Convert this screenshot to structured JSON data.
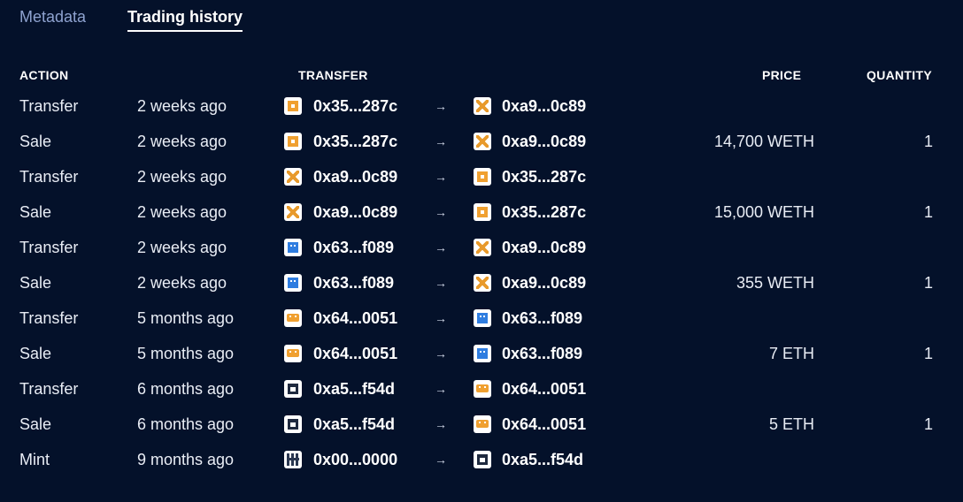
{
  "tabs": [
    {
      "label": "Metadata"
    },
    {
      "label": "Trading history"
    }
  ],
  "headers": {
    "action": "ACTION",
    "transfer": "TRANSFER",
    "price": "PRICE",
    "quantity": "QUANTITY"
  },
  "rows": [
    {
      "action": "Transfer",
      "time": "2 weeks ago",
      "from": "0x35...287c",
      "from_icon": "orange-square-avatar-icon",
      "to": "0xa9...0c89",
      "to_icon": "orange-x-avatar-icon",
      "price": "",
      "quantity": ""
    },
    {
      "action": "Sale",
      "time": "2 weeks ago",
      "from": "0x35...287c",
      "from_icon": "orange-square-avatar-icon",
      "to": "0xa9...0c89",
      "to_icon": "orange-x-avatar-icon",
      "price": "14,700 WETH",
      "quantity": "1"
    },
    {
      "action": "Transfer",
      "time": "2 weeks ago",
      "from": "0xa9...0c89",
      "from_icon": "orange-x-avatar-icon",
      "to": "0x35...287c",
      "to_icon": "orange-square-avatar-icon",
      "price": "",
      "quantity": ""
    },
    {
      "action": "Sale",
      "time": "2 weeks ago",
      "from": "0xa9...0c89",
      "from_icon": "orange-x-avatar-icon",
      "to": "0x35...287c",
      "to_icon": "orange-square-avatar-icon",
      "price": "15,000 WETH",
      "quantity": "1"
    },
    {
      "action": "Transfer",
      "time": "2 weeks ago",
      "from": "0x63...f089",
      "from_icon": "blue-avatar-icon",
      "to": "0xa9...0c89",
      "to_icon": "orange-x-avatar-icon",
      "price": "",
      "quantity": ""
    },
    {
      "action": "Sale",
      "time": "2 weeks ago",
      "from": "0x63...f089",
      "from_icon": "blue-avatar-icon",
      "to": "0xa9...0c89",
      "to_icon": "orange-x-avatar-icon",
      "price": "355 WETH",
      "quantity": "1"
    },
    {
      "action": "Transfer",
      "time": "5 months ago",
      "from": "0x64...0051",
      "from_icon": "orange-crab-avatar-icon",
      "to": "0x63...f089",
      "to_icon": "blue-avatar-icon",
      "price": "",
      "quantity": ""
    },
    {
      "action": "Sale",
      "time": "5 months ago",
      "from": "0x64...0051",
      "from_icon": "orange-crab-avatar-icon",
      "to": "0x63...f089",
      "to_icon": "blue-avatar-icon",
      "price": "7 ETH",
      "quantity": "1"
    },
    {
      "action": "Transfer",
      "time": "6 months ago",
      "from": "0xa5...f54d",
      "from_icon": "dark-box-avatar-icon",
      "to": "0x64...0051",
      "to_icon": "orange-crab-avatar-icon",
      "price": "",
      "quantity": ""
    },
    {
      "action": "Sale",
      "time": "6 months ago",
      "from": "0xa5...f54d",
      "from_icon": "dark-box-avatar-icon",
      "to": "0x64...0051",
      "to_icon": "orange-crab-avatar-icon",
      "price": "5 ETH",
      "quantity": "1"
    },
    {
      "action": "Mint",
      "time": "9 months ago",
      "from": "0x00...0000",
      "from_icon": "dark-pattern-avatar-icon",
      "to": "0xa5...f54d",
      "to_icon": "dark-box-avatar-icon",
      "price": "",
      "quantity": ""
    }
  ],
  "arrow": "→",
  "colors": {
    "background": "#04112a",
    "inactive_tab": "#8ea2cf",
    "text": "#e9edf5"
  }
}
